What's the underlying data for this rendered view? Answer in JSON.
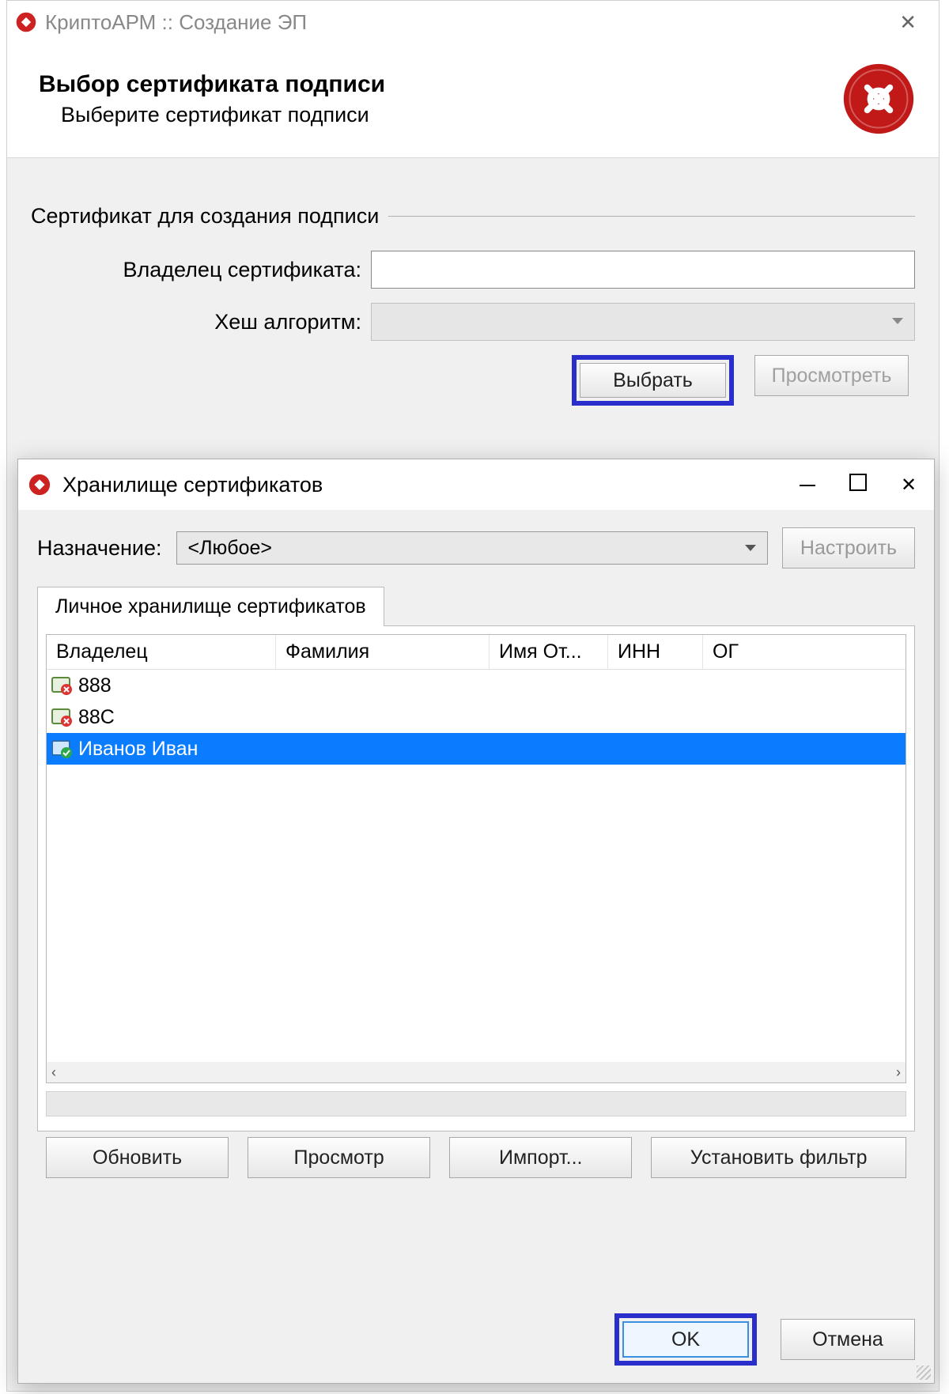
{
  "parent": {
    "title": "КриптоАРМ :: Создание ЭП",
    "headerTitle": "Выбор сертификата подписи",
    "headerSubtitle": "Выберите сертификат подписи",
    "fieldsetTitle": "Сертификат для создания подписи",
    "ownerLabel": "Владелец сертификата:",
    "hashLabel": "Хеш алгоритм:",
    "selectBtn": "Выбрать",
    "viewBtn": "Просмотреть"
  },
  "child": {
    "title": "Хранилище сертификатов",
    "purposeLabel": "Назначение:",
    "purposeValue": "<Любое>",
    "configureBtn": "Настроить",
    "tabLabel": "Личное хранилище сертификатов",
    "columns": {
      "c1": "Владелец",
      "c2": "Фамилия",
      "c3": "Имя От...",
      "c4": "ИНН",
      "c5": "ОГ"
    },
    "rows": [
      {
        "owner": "888",
        "status": "bad",
        "selected": false
      },
      {
        "owner": "88C",
        "status": "bad",
        "selected": false
      },
      {
        "owner": "Иванов Иван",
        "status": "good",
        "selected": true
      }
    ],
    "refreshBtn": "Обновить",
    "previewBtn": "Просмотр",
    "importBtn": "Импорт...",
    "filterBtn": "Установить фильтр",
    "okBtn": "OK",
    "cancelBtn": "Отмена"
  }
}
